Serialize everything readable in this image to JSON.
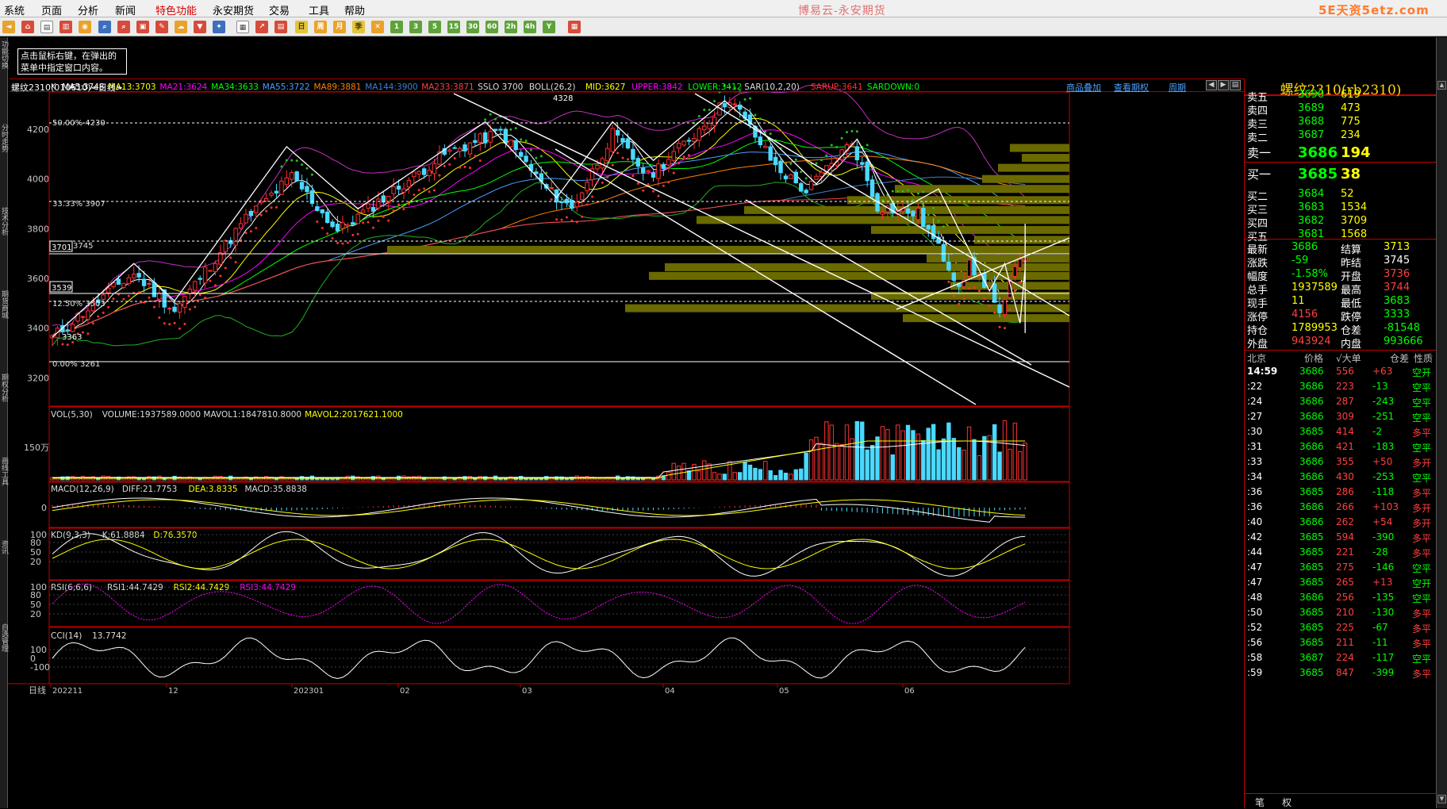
{
  "menu": {
    "items": [
      "系统",
      "页面",
      "分析",
      "新闻",
      "特色功能",
      "永安期货",
      "交易",
      "工具",
      "帮助"
    ],
    "highlight_index": 4,
    "app_title": "博易云-永安期货",
    "brand_logo": "5E天资5etz.com"
  },
  "left_tabs": [
    "功能切换",
    "分时走势",
    "技术分析",
    "期货商城",
    "期权分析",
    "画线工具",
    "资讯",
    "自选管理"
  ],
  "hint": "点击鼠标右键，在弹出的菜单中指定窗口内容。",
  "chart_header": {
    "name": "螺纹2310(010610)<日线>",
    "links": [
      "商品叠加",
      "查看期权",
      "周期"
    ]
  },
  "indicator_legend": [
    {
      "t": "K",
      "c": "#dddddd"
    },
    {
      "t": "MA5:3748",
      "c": "#ffffff"
    },
    {
      "t": "MA13:3703",
      "c": "#ffff00"
    },
    {
      "t": "MA21:3624",
      "c": "#ff00ff"
    },
    {
      "t": "MA34:3633",
      "c": "#00ff00"
    },
    {
      "t": "MA55:3722",
      "c": "#4a9fff"
    },
    {
      "t": "MA89:3881",
      "c": "#ff8000"
    },
    {
      "t": "MA144:3900",
      "c": "#3f7fd0"
    },
    {
      "t": "MA233:3871",
      "c": "#ff4040"
    },
    {
      "t": "SSLO 3700",
      "c": "#dddddd"
    },
    {
      "t": "BOLL(26,2)",
      "c": "#dddddd"
    },
    {
      "t": "MID:3627",
      "c": "#ffff00"
    },
    {
      "t": "UPPER:3842",
      "c": "#ff00ff"
    },
    {
      "t": "LOWER:3412",
      "c": "#00ff00"
    },
    {
      "t": "SAR(10,2,20)",
      "c": "#dddddd"
    },
    {
      "t": "SARUP:3641",
      "c": "#ff3030"
    },
    {
      "t": "SARDOWN:0",
      "c": "#00ff00"
    }
  ],
  "price_axis": [
    "4200",
    "4000",
    "3800",
    "3600",
    "3400",
    "3200"
  ],
  "fib_labels": [
    {
      "text": "50.00%",
      "value": "4230"
    },
    {
      "text": "33.33%",
      "value": "3907"
    },
    {
      "text": "3745"
    },
    {
      "text": "12.50%",
      "value": "3503"
    },
    {
      "text": "0.00%",
      "value": "3261"
    }
  ],
  "price_boxes": [
    "3701",
    "3539"
  ],
  "extreme_labels": {
    "high": "4328",
    "low": "3363"
  },
  "volume_legend": [
    {
      "t": "VOL(5,30)",
      "c": "#dddddd"
    },
    {
      "t": "VOLUME:1937589.0000",
      "c": "#dddddd"
    },
    {
      "t": "MAVOL1:1847810.8000",
      "c": "#dddddd"
    },
    {
      "t": "MAVOL2:2017621.1000",
      "c": "#ffff00"
    }
  ],
  "volume_axis": "150万",
  "macd_legend": [
    {
      "t": "MACD(12,26,9)",
      "c": "#dddddd"
    },
    {
      "t": "DIFF:21.7753",
      "c": "#dddddd"
    },
    {
      "t": "DEA:3.8335",
      "c": "#ffff00"
    },
    {
      "t": "MACD:35.8838",
      "c": "#dddddd"
    }
  ],
  "macd_axis": "0",
  "kd_legend": [
    {
      "t": "KD(9,3,3)",
      "c": "#dddddd"
    },
    {
      "t": "K:61.8884",
      "c": "#dddddd"
    },
    {
      "t": "D:76.3570",
      "c": "#ffff00"
    }
  ],
  "kd_axis": [
    "100",
    "80",
    "50",
    "20"
  ],
  "rsi_legend": [
    {
      "t": "RSI(6,6,6)",
      "c": "#dddddd"
    },
    {
      "t": "RSI1:44.7429",
      "c": "#dddddd"
    },
    {
      "t": "RSI2:44.7429",
      "c": "#ffff00"
    },
    {
      "t": "RSI3:44.7429",
      "c": "#ff00ff"
    }
  ],
  "rsi_axis": [
    "100",
    "80",
    "50",
    "20"
  ],
  "cci_legend": [
    {
      "t": "CCI(14)",
      "c": "#dddddd"
    },
    {
      "t": "13.7742",
      "c": "#dddddd"
    }
  ],
  "cci_axis": [
    "100",
    "0",
    "-100"
  ],
  "date_axis": {
    "label": "日线",
    "dates": [
      "202211",
      "12",
      "202301",
      "02",
      "03",
      "04",
      "05",
      "06"
    ]
  },
  "quote": {
    "title": "螺纹2310(rb2310)",
    "asks": [
      {
        "label": "卖五",
        "price": "3690",
        "vol": "619"
      },
      {
        "label": "卖四",
        "price": "3689",
        "vol": "473"
      },
      {
        "label": "卖三",
        "price": "3688",
        "vol": "775"
      },
      {
        "label": "卖二",
        "price": "3687",
        "vol": "234"
      },
      {
        "label": "卖一",
        "price": "3686",
        "vol": "194"
      }
    ],
    "bids": [
      {
        "label": "买一",
        "price": "3685",
        "vol": "38"
      },
      {
        "label": "买二",
        "price": "3684",
        "vol": "52"
      },
      {
        "label": "买三",
        "price": "3683",
        "vol": "1534"
      },
      {
        "label": "买四",
        "price": "3682",
        "vol": "3709"
      },
      {
        "label": "买五",
        "price": "3681",
        "vol": "1568"
      }
    ],
    "stats": [
      {
        "l1": "最新",
        "v1": "3686",
        "c1": "#00ff00",
        "l2": "结算",
        "v2": "3713",
        "c2": "#ffff00"
      },
      {
        "l1": "涨跌",
        "v1": "-59",
        "c1": "#00ff00",
        "l2": "昨结",
        "v2": "3745",
        "c2": "#ffffff"
      },
      {
        "l1": "幅度",
        "v1": "-1.58%",
        "c1": "#00ff00",
        "l2": "开盘",
        "v2": "3736",
        "c2": "#ff4040"
      },
      {
        "l1": "总手",
        "v1": "1937589",
        "c1": "#ffff00",
        "l2": "最高",
        "v2": "3744",
        "c2": "#ff4040"
      },
      {
        "l1": "现手",
        "v1": "11",
        "c1": "#ffff00",
        "l2": "最低",
        "v2": "3683",
        "c2": "#00ff00"
      },
      {
        "l1": "涨停",
        "v1": "4156",
        "c1": "#ff4040",
        "l2": "跌停",
        "v2": "3333",
        "c2": "#00ff00"
      },
      {
        "l1": "持仓",
        "v1": "1789953",
        "c1": "#ffff00",
        "l2": "仓差",
        "v2": "-81548",
        "c2": "#00ff00"
      },
      {
        "l1": "外盘",
        "v1": "943924",
        "c1": "#ff4040",
        "l2": "内盘",
        "v2": "993666",
        "c2": "#00ff00"
      }
    ],
    "tick_headers": [
      "北京",
      "价格",
      "√大单",
      "仓差",
      "性质"
    ],
    "ticks": [
      {
        "t": "14:59",
        "p": "3686",
        "v": "556",
        "d": "+63",
        "n": "空开"
      },
      {
        "t": ":22",
        "p": "3686",
        "v": "223",
        "d": "-13",
        "n": "空平"
      },
      {
        "t": ":24",
        "p": "3686",
        "v": "287",
        "d": "-243",
        "n": "空平"
      },
      {
        "t": ":27",
        "p": "3686",
        "v": "309",
        "d": "-251",
        "n": "空平"
      },
      {
        "t": ":30",
        "p": "3685",
        "v": "414",
        "d": "-2",
        "n": "多平"
      },
      {
        "t": ":31",
        "p": "3686",
        "v": "421",
        "d": "-183",
        "n": "空平"
      },
      {
        "t": ":33",
        "p": "3686",
        "v": "355",
        "d": "+50",
        "n": "多开"
      },
      {
        "t": ":34",
        "p": "3686",
        "v": "430",
        "d": "-253",
        "n": "空平"
      },
      {
        "t": ":36",
        "p": "3685",
        "v": "286",
        "d": "-118",
        "n": "多平"
      },
      {
        "t": ":36",
        "p": "3686",
        "v": "266",
        "d": "+103",
        "n": "多开"
      },
      {
        "t": ":40",
        "p": "3686",
        "v": "262",
        "d": "+54",
        "n": "多开"
      },
      {
        "t": ":42",
        "p": "3685",
        "v": "594",
        "d": "-390",
        "n": "多平"
      },
      {
        "t": ":44",
        "p": "3685",
        "v": "221",
        "d": "-28",
        "n": "多平"
      },
      {
        "t": ":47",
        "p": "3685",
        "v": "275",
        "d": "-146",
        "n": "空平"
      },
      {
        "t": ":47",
        "p": "3685",
        "v": "265",
        "d": "+13",
        "n": "空开"
      },
      {
        "t": ":48",
        "p": "3686",
        "v": "256",
        "d": "-135",
        "n": "空平"
      },
      {
        "t": ":50",
        "p": "3685",
        "v": "210",
        "d": "-130",
        "n": "多平"
      },
      {
        "t": ":52",
        "p": "3685",
        "v": "225",
        "d": "-67",
        "n": "多平"
      },
      {
        "t": ":56",
        "p": "3685",
        "v": "211",
        "d": "-11",
        "n": "多平"
      },
      {
        "t": ":58",
        "p": "3687",
        "v": "224",
        "d": "-117",
        "n": "空平"
      },
      {
        "t": ":59",
        "p": "3685",
        "v": "847",
        "d": "-399",
        "n": "多平"
      }
    ],
    "bottom_tabs": [
      "笔",
      "权"
    ]
  }
}
